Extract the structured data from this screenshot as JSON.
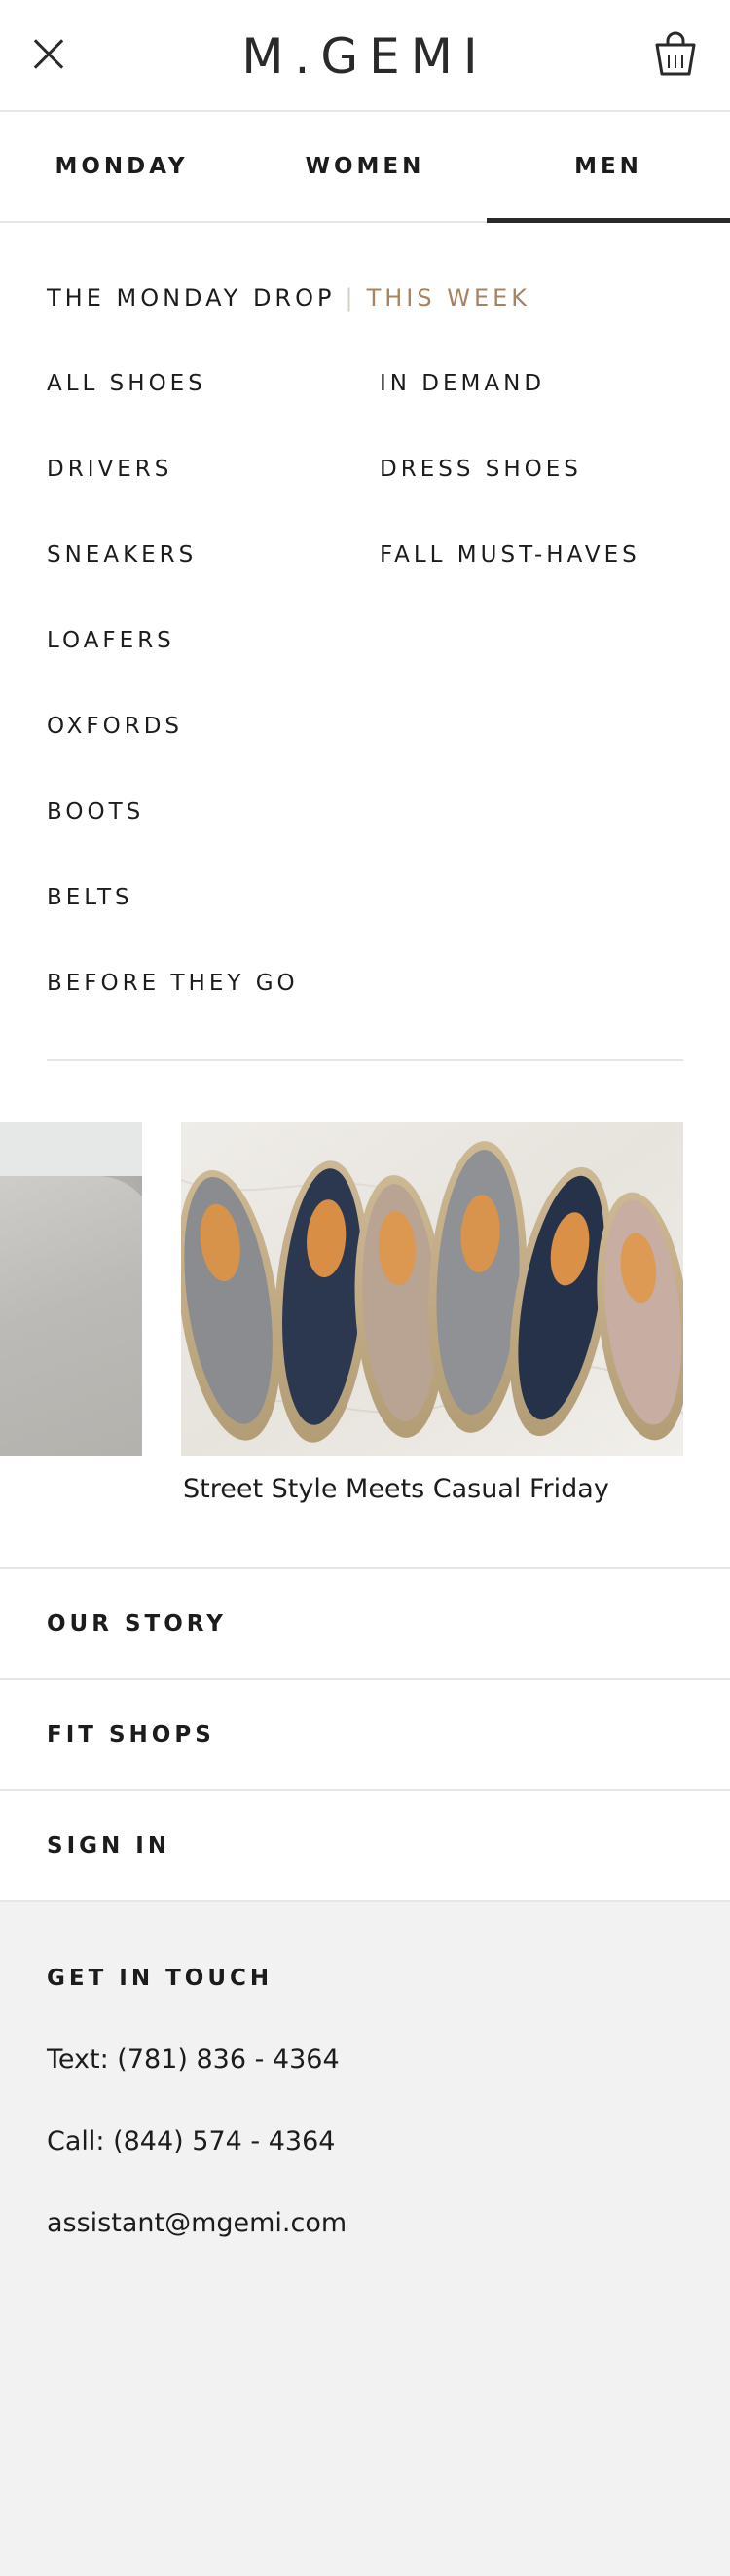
{
  "header": {
    "logo": "M.GEMI",
    "close_icon": "close-icon",
    "cart_icon": "shopping-bag-icon"
  },
  "tabs": [
    {
      "label": "MONDAY",
      "active": false
    },
    {
      "label": "WOMEN",
      "active": false
    },
    {
      "label": "MEN",
      "active": true
    }
  ],
  "menu": {
    "heading": "THE MONDAY DROP",
    "separator": "|",
    "heading_accent": "THIS WEEK",
    "left": [
      "ALL SHOES",
      "DRIVERS",
      "SNEAKERS",
      "LOAFERS",
      "OXFORDS",
      "BOOTS",
      "BELTS",
      "BEFORE THEY GO"
    ],
    "right": [
      "IN DEMAND",
      "DRESS SHOES",
      "FALL MUST-HAVES"
    ]
  },
  "carousel": {
    "caption": "Street Style Meets Casual Friday"
  },
  "links": [
    "OUR STORY",
    "FIT SHOPS",
    "SIGN IN"
  ],
  "footer": {
    "title": "GET IN TOUCH",
    "text_line": "Text: (781) 836 - 4364",
    "call_line": "Call: (844) 574 - 4364",
    "email": "assistant@mgemi.com"
  },
  "colors": {
    "accent": "#a88360",
    "text": "#1c1c1c",
    "footer_bg": "#f2f2f2",
    "divider": "#e6e6e6"
  }
}
